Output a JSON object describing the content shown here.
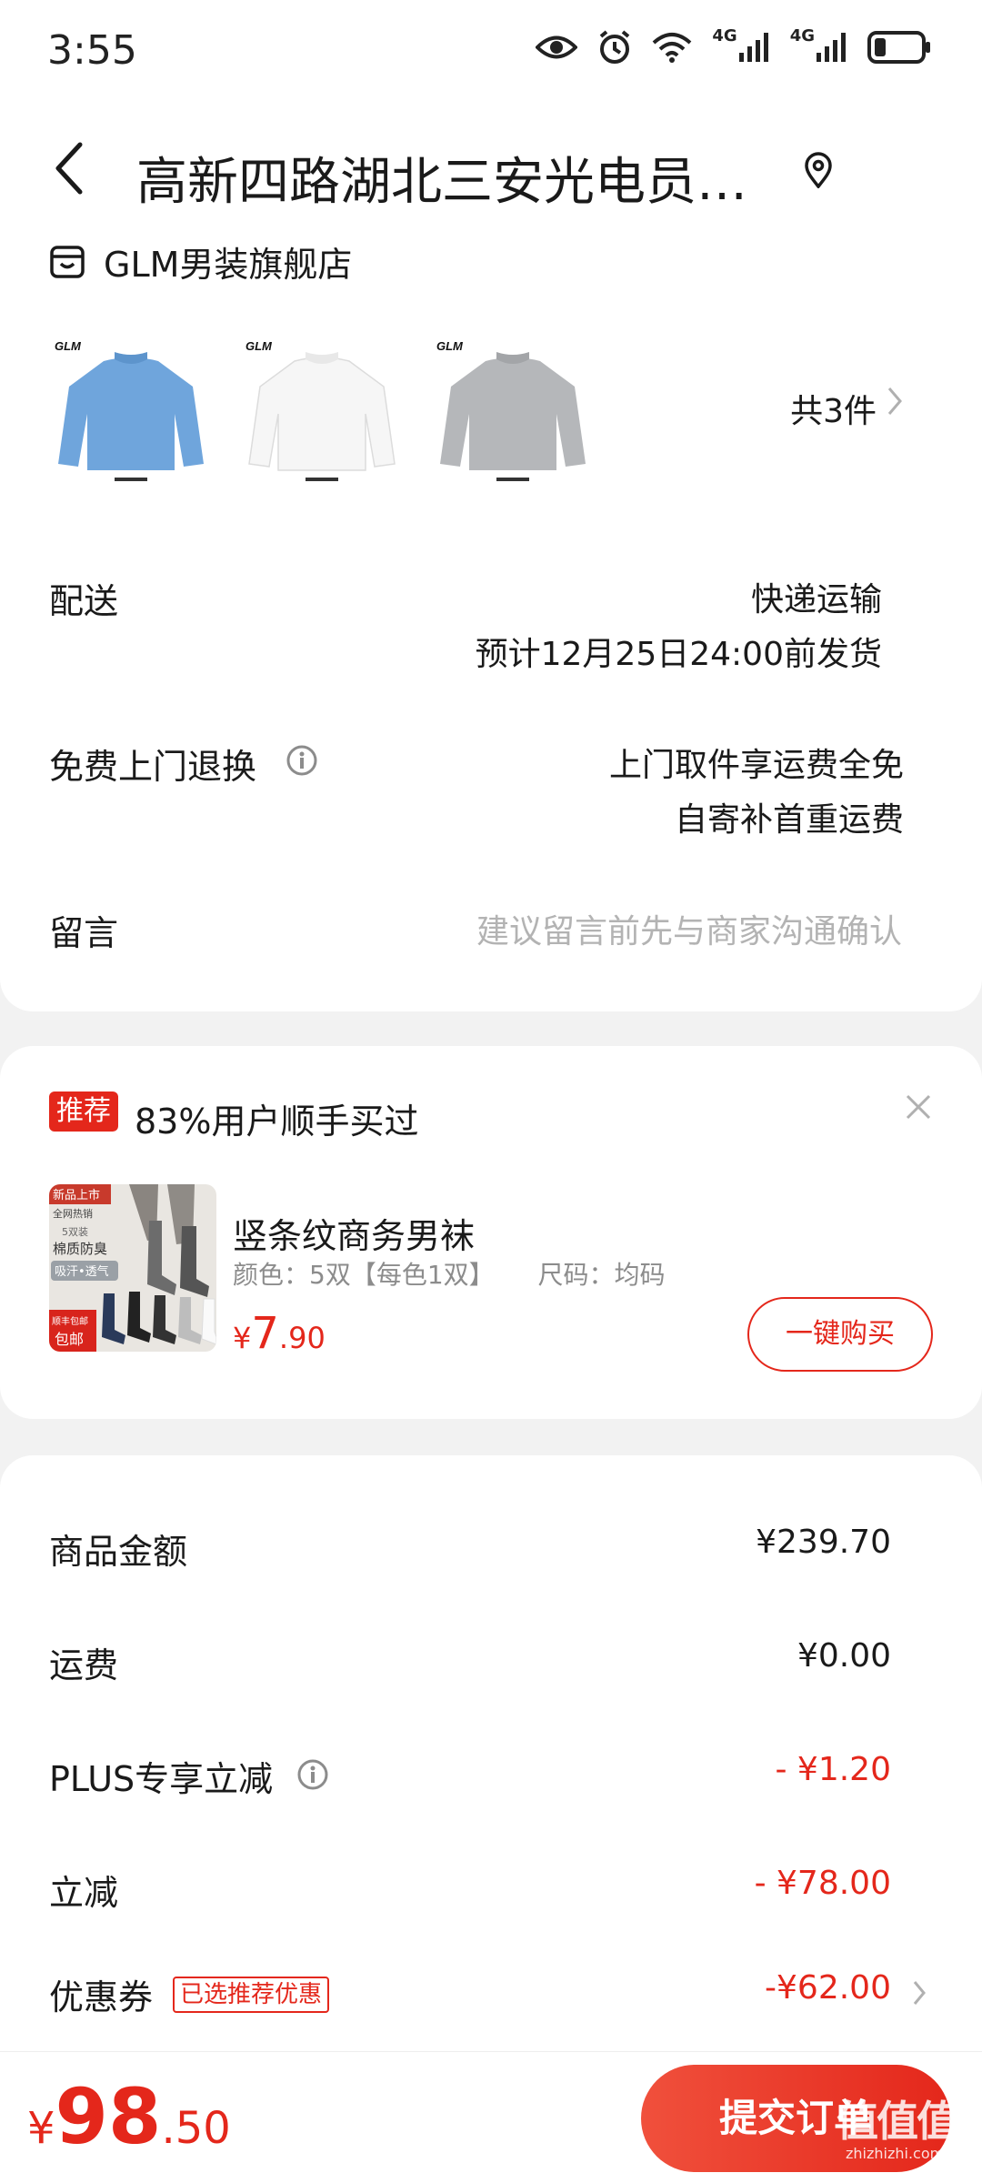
{
  "status_bar": {
    "time": "3:55",
    "net1": "4G",
    "net2": "4G"
  },
  "header": {
    "address": "高新四路湖北三安光电员工...",
    "icons": [
      "back-icon",
      "location-icon"
    ]
  },
  "store": {
    "name": "GLM男装旗舰店",
    "icon": "store-icon"
  },
  "products": {
    "items": [
      {
        "brand": "GLM",
        "color": "#6fa5dc"
      },
      {
        "brand": "GLM",
        "color": "#f4f4f4"
      },
      {
        "brand": "GLM",
        "color": "#b5b7ba"
      }
    ],
    "count_label": "共3件"
  },
  "delivery": {
    "label": "配送",
    "method": "快递运输",
    "estimate": "预计12月25日24:00前发货"
  },
  "returns": {
    "label": "免费上门退换",
    "line1": "上门取件享运费全免",
    "line2": "自寄补首重运费"
  },
  "message": {
    "label": "留言",
    "placeholder": "建议留言前先与商家沟通确认"
  },
  "recommend": {
    "tag": "推荐",
    "title": "83%用户顺手买过",
    "product_name": "竖条纹商务男袜",
    "spec_color": "颜色：5双【每色1双】",
    "spec_size": "尺码：均码",
    "price_currency": "¥",
    "price_int": "7",
    "price_dec": ".90",
    "buy_label": "一键购买",
    "image_text": {
      "badge": "新品上市",
      "hot": "全网热销",
      "pack": "5双装",
      "feature1": "棉质防臭",
      "feature2": "吸汗•透气",
      "ship1": "顺丰包邮",
      "ship2": "包邮"
    }
  },
  "summary": {
    "rows": [
      {
        "label": "商品金额",
        "value": "¥239.70"
      },
      {
        "label": "运费",
        "value": "¥0.00"
      },
      {
        "label": "PLUS专享立减",
        "value": "- ¥1.20"
      },
      {
        "label": "立减",
        "value": "- ¥78.00"
      },
      {
        "label": "优惠券",
        "value": "-¥62.00",
        "tag": "已选推荐优惠"
      }
    ],
    "accent": "#e4271b"
  },
  "bottom": {
    "currency": "¥",
    "total_int": "98",
    "total_dec": ".50",
    "submit_label": "提交订单",
    "watermark": "值值值",
    "watermark_sub": "zhizhizhi.com"
  }
}
